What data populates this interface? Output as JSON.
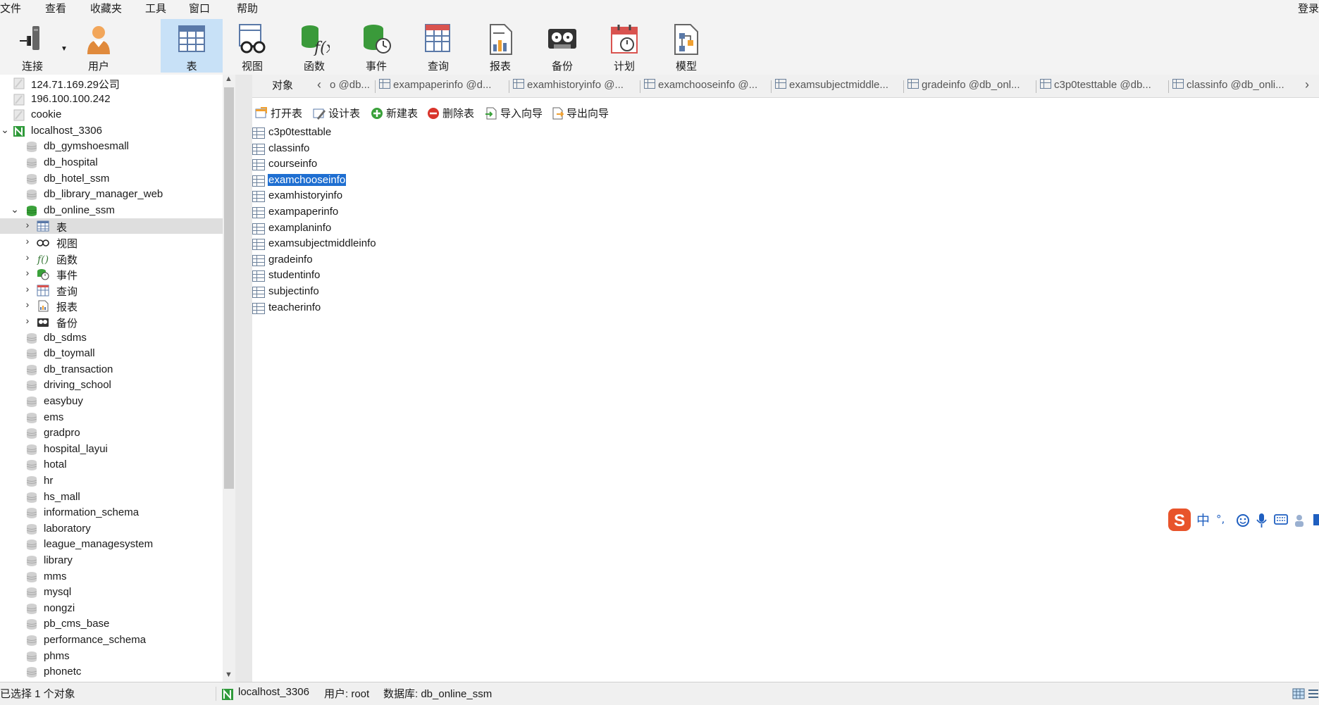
{
  "menu": [
    "文件",
    "查看",
    "收藏夹",
    "工具",
    "窗口",
    "帮助"
  ],
  "login_label": "登录",
  "toolbar": [
    {
      "label": "连接",
      "icon": "connection-icon"
    },
    {
      "label": "用户",
      "icon": "user-icon"
    },
    {
      "label": "表",
      "icon": "table-icon",
      "active": true
    },
    {
      "label": "视图",
      "icon": "view-icon"
    },
    {
      "label": "函数",
      "icon": "function-icon"
    },
    {
      "label": "事件",
      "icon": "event-icon"
    },
    {
      "label": "查询",
      "icon": "query-icon"
    },
    {
      "label": "报表",
      "icon": "report-icon"
    },
    {
      "label": "备份",
      "icon": "backup-icon"
    },
    {
      "label": "计划",
      "icon": "schedule-icon"
    },
    {
      "label": "模型",
      "icon": "model-icon"
    }
  ],
  "tree": [
    {
      "label": "124.71.169.29公司",
      "level": 0,
      "icon": "server-icon"
    },
    {
      "label": "196.100.100.242",
      "level": 0,
      "icon": "server-icon"
    },
    {
      "label": "cookie",
      "level": 0,
      "icon": "server-icon"
    },
    {
      "label": "localhost_3306",
      "level": 0,
      "icon": "server-connected-icon",
      "expanded": true
    },
    {
      "label": "db_gymshoesmall",
      "level": 1,
      "icon": "database-icon"
    },
    {
      "label": "db_hospital",
      "level": 1,
      "icon": "database-icon"
    },
    {
      "label": "db_hotel_ssm",
      "level": 1,
      "icon": "database-icon"
    },
    {
      "label": "db_library_manager_web",
      "level": 1,
      "icon": "database-icon"
    },
    {
      "label": "db_online_ssm",
      "level": 1,
      "icon": "database-open-icon",
      "expanded": true
    },
    {
      "label": "表",
      "level": 2,
      "icon": "table-icon",
      "selected": true
    },
    {
      "label": "视图",
      "level": 2,
      "icon": "view-icon"
    },
    {
      "label": "函数",
      "level": 2,
      "icon": "function-icon"
    },
    {
      "label": "事件",
      "level": 2,
      "icon": "event-icon"
    },
    {
      "label": "查询",
      "level": 2,
      "icon": "query-icon"
    },
    {
      "label": "报表",
      "level": 2,
      "icon": "report-icon"
    },
    {
      "label": "备份",
      "level": 2,
      "icon": "backup-icon"
    },
    {
      "label": "db_sdms",
      "level": 1,
      "icon": "database-icon"
    },
    {
      "label": "db_toymall",
      "level": 1,
      "icon": "database-icon"
    },
    {
      "label": "db_transaction",
      "level": 1,
      "icon": "database-icon"
    },
    {
      "label": "driving_school",
      "level": 1,
      "icon": "database-icon"
    },
    {
      "label": "easybuy",
      "level": 1,
      "icon": "database-icon"
    },
    {
      "label": "ems",
      "level": 1,
      "icon": "database-icon"
    },
    {
      "label": "gradpro",
      "level": 1,
      "icon": "database-icon"
    },
    {
      "label": "hospital_layui",
      "level": 1,
      "icon": "database-icon"
    },
    {
      "label": "hotal",
      "level": 1,
      "icon": "database-icon"
    },
    {
      "label": "hr",
      "level": 1,
      "icon": "database-icon"
    },
    {
      "label": "hs_mall",
      "level": 1,
      "icon": "database-icon"
    },
    {
      "label": "information_schema",
      "level": 1,
      "icon": "database-icon"
    },
    {
      "label": "laboratory",
      "level": 1,
      "icon": "database-icon"
    },
    {
      "label": "league_managesystem",
      "level": 1,
      "icon": "database-icon"
    },
    {
      "label": "library",
      "level": 1,
      "icon": "database-icon"
    },
    {
      "label": "mms",
      "level": 1,
      "icon": "database-icon"
    },
    {
      "label": "mysql",
      "level": 1,
      "icon": "database-icon"
    },
    {
      "label": "nongzi",
      "level": 1,
      "icon": "database-icon"
    },
    {
      "label": "pb_cms_base",
      "level": 1,
      "icon": "database-icon"
    },
    {
      "label": "performance_schema",
      "level": 1,
      "icon": "database-icon"
    },
    {
      "label": "phms",
      "level": 1,
      "icon": "database-icon"
    },
    {
      "label": "phonetc",
      "level": 1,
      "icon": "database-icon"
    }
  ],
  "tabs": {
    "objects_label": "对象",
    "items": [
      "o @db...",
      "exampaperinfo @d...",
      "examhistoryinfo @...",
      "examchooseinfo @...",
      "examsubjectmiddle...",
      "gradeinfo @db_onl...",
      "c3p0testtable @db...",
      "classinfo @db_onli..."
    ]
  },
  "actions": [
    {
      "label": "打开表",
      "icon": "open-table-icon"
    },
    {
      "label": "设计表",
      "icon": "design-table-icon"
    },
    {
      "label": "新建表",
      "icon": "new-table-icon"
    },
    {
      "label": "删除表",
      "icon": "delete-table-icon"
    },
    {
      "label": "导入向导",
      "icon": "import-wizard-icon"
    },
    {
      "label": "导出向导",
      "icon": "export-wizard-icon"
    }
  ],
  "tables": [
    {
      "name": "c3p0testtable"
    },
    {
      "name": "classinfo"
    },
    {
      "name": "courseinfo"
    },
    {
      "name": "examchooseinfo",
      "selected": true
    },
    {
      "name": "examhistoryinfo"
    },
    {
      "name": "exampaperinfo"
    },
    {
      "name": "examplaninfo"
    },
    {
      "name": "examsubjectmiddleinfo"
    },
    {
      "name": "gradeinfo"
    },
    {
      "name": "studentinfo"
    },
    {
      "name": "subjectinfo"
    },
    {
      "name": "teacherinfo"
    }
  ],
  "ime": {
    "lang_label": "中",
    "punct_label": "°,"
  },
  "status": {
    "selection": "已选择 1 个对象",
    "connection": "localhost_3306",
    "user": "用户: root",
    "database": "数据库: db_online_ssm"
  },
  "colors": {
    "selection": "#1f6fd1",
    "active_toolbar": "#c8e1f7",
    "ime_brand": "#e8542b",
    "db_icon_open": "#3aa13a"
  }
}
